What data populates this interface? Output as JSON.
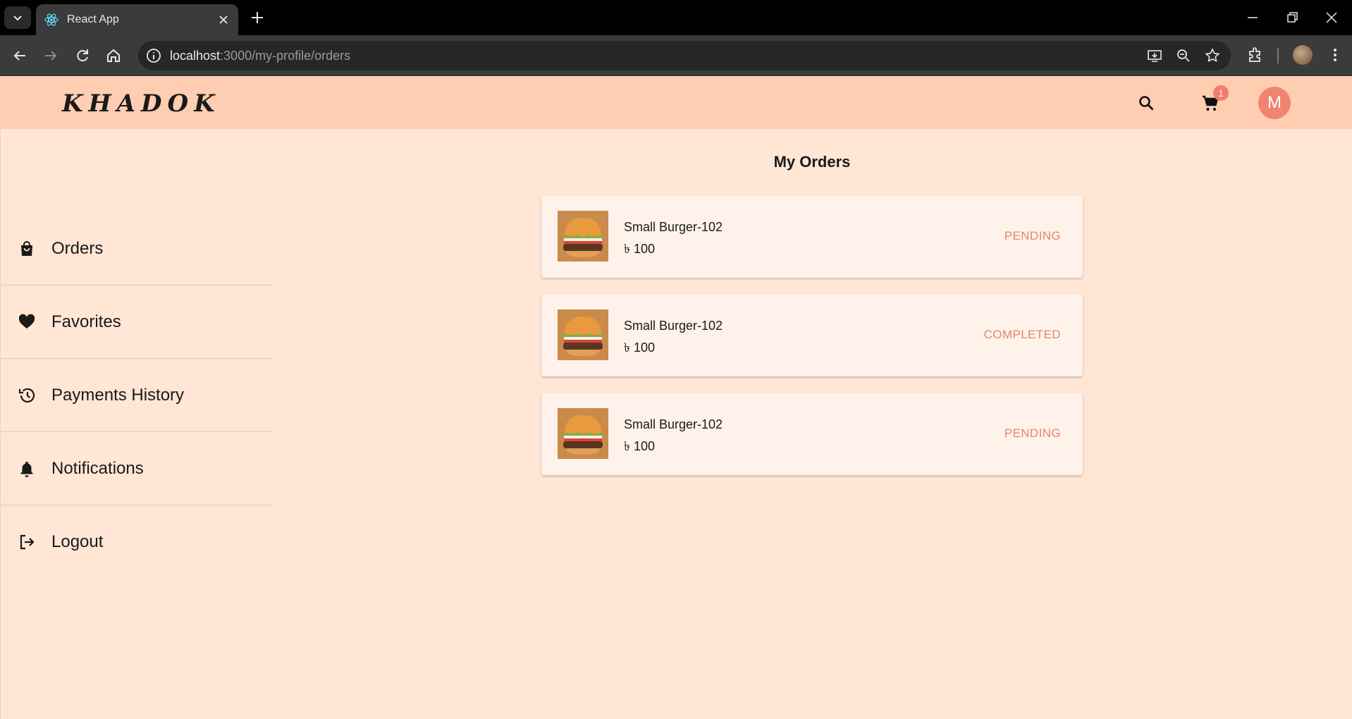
{
  "browser": {
    "tab_title": "React App",
    "url_host": "localhost",
    "url_path": ":3000/my-profile/orders"
  },
  "header": {
    "logo": "KHADOK",
    "cart_count": "1",
    "avatar_initial": "M"
  },
  "sidebar": {
    "items": [
      {
        "label": "Orders",
        "icon": "shopping-bag-icon"
      },
      {
        "label": "Favorites",
        "icon": "heart-icon"
      },
      {
        "label": "Payments History",
        "icon": "history-icon"
      },
      {
        "label": "Notifications",
        "icon": "bell-icon"
      },
      {
        "label": "Logout",
        "icon": "logout-icon"
      }
    ]
  },
  "main": {
    "title": "My Orders",
    "orders": [
      {
        "name": "Small Burger-102",
        "price": "৳ 100",
        "status": "PENDING"
      },
      {
        "name": "Small Burger-102",
        "price": "৳ 100",
        "status": "COMPLETED"
      },
      {
        "name": "Small Burger-102",
        "price": "৳ 100",
        "status": "PENDING"
      }
    ]
  },
  "colors": {
    "page_bg": "#ffe6d5",
    "header_bg": "#ffcdb2",
    "card_bg": "#fff2ea",
    "status": "#e08868",
    "avatar": "#f08470"
  }
}
